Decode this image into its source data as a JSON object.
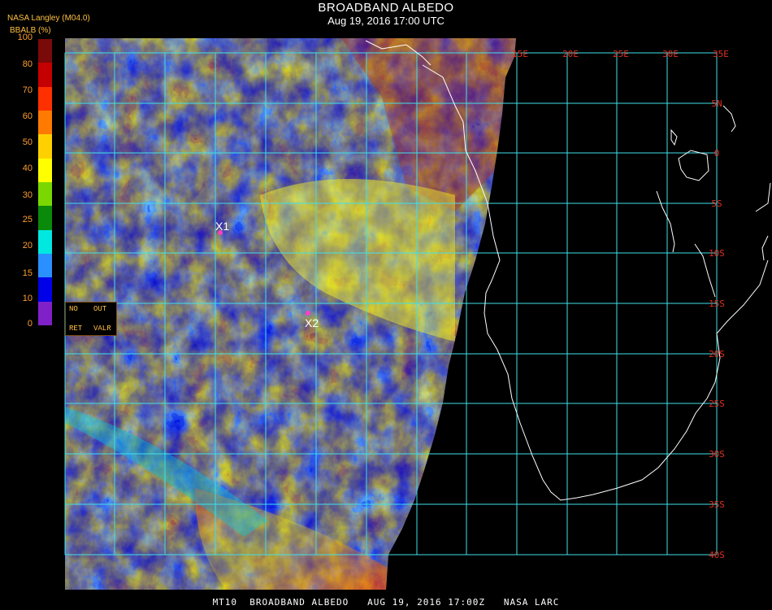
{
  "header": {
    "title": "BROADBAND ALBEDO",
    "datetime": "Aug 19, 2016 17:00 UTC",
    "provider": "NASA Langley (M04.0)"
  },
  "colorbar": {
    "label": "BBALB (%)",
    "ticks": [
      "100",
      "80",
      "70",
      "60",
      "50",
      "40",
      "30",
      "25",
      "20",
      "15",
      "10",
      "0"
    ],
    "colors": [
      "#7a0a0a",
      "#c40000",
      "#ff3000",
      "#ff7a00",
      "#ffd000",
      "#ffff00",
      "#7ad800",
      "#0a8a0a",
      "#00e8e0",
      "#2a90ff",
      "#0000e8",
      "#8020c8"
    ]
  },
  "map": {
    "lon_labels": [
      "15E",
      "20E",
      "25E",
      "30E",
      "35E"
    ],
    "lat_labels": [
      "5N",
      "0",
      "5S",
      "10S",
      "15S",
      "20S",
      "25S",
      "30S",
      "35S",
      "40S"
    ],
    "markers": [
      {
        "label": "X1"
      },
      {
        "label": "X2"
      }
    ],
    "colors": {
      "grid": "#40e0e8",
      "coast": "#ffffff",
      "grid_label": "#e03020",
      "marker": "#ff40c0"
    }
  },
  "controls": {
    "no": "NO",
    "out": "OUT",
    "ret": "RET",
    "valr": "VALR"
  },
  "footer": {
    "text": "MT10  BROADBAND ALBEDO   AUG 19, 2016 17:00Z   NASA LARC"
  }
}
